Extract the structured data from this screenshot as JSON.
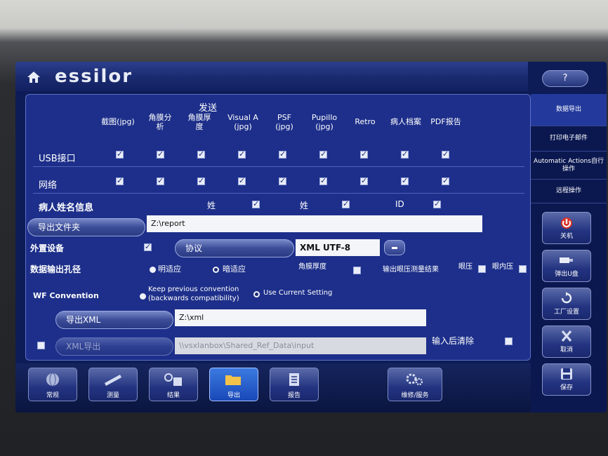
{
  "header": {
    "logo_text": "essilor",
    "help_label": "?"
  },
  "columns": {
    "group_title": "发送",
    "headers": [
      "截图(jpg)",
      "角膜分析",
      "角膜厚度",
      "Visual A (jpg)",
      "PSF (jpg)",
      "Pupillo (jpg)",
      "Retro",
      "病人档案",
      "PDF报告"
    ],
    "rows": [
      {
        "label": "USB接口",
        "checked": [
          true,
          true,
          true,
          true,
          true,
          true,
          true,
          true,
          true
        ]
      },
      {
        "label": "网络",
        "checked": [
          true,
          true,
          true,
          true,
          true,
          true,
          true,
          true,
          true
        ]
      }
    ]
  },
  "patient_name": {
    "label": "病人姓名信息",
    "options": [
      {
        "label": "姓",
        "checked": true
      },
      {
        "label": "姓",
        "checked": true
      },
      {
        "label": "ID",
        "checked": true
      }
    ]
  },
  "export_folder": {
    "label": "导出文件夹",
    "value": "Z:\\report"
  },
  "external_device": {
    "label": "外置设备",
    "checked": true,
    "protocol_label": "协议",
    "protocol_value": "XML UTF-8"
  },
  "data_output": {
    "label": "数据输出孔径",
    "option1": "明适应",
    "option2": "暗适应",
    "extra1": "角膜厚度",
    "extra2": "输出眼压测量结果",
    "extra3": "眼压",
    "extra4": "眼内压"
  },
  "wf_convention": {
    "label": "WF Convention",
    "keep_previous": "Keep previous convention",
    "keep_previous_sub": "(backwards compatibility)",
    "use_current": "Use Current Setting"
  },
  "export_xml": {
    "label": "导出XML",
    "value": "Z:\\xml"
  },
  "xml_export": {
    "label": "XML导出",
    "value": "\\\\vsxlanbox\\Shared_Ref_Data\\input",
    "clear_label": "输入后清除"
  },
  "sidebar": {
    "tabs": [
      "数据导出",
      "打印电子邮件",
      "Automatic Actions自行操作",
      "远程操作"
    ],
    "buttons": [
      "关机",
      "弹出U盘",
      "工厂设置",
      "取消",
      "保存"
    ]
  },
  "toolbar": {
    "items": [
      "常规",
      "测量",
      "结果",
      "导出",
      "报告",
      "维修/服务"
    ]
  },
  "colors": {
    "accent": "#1d2f8a",
    "active_tool": "#2a62d0"
  }
}
